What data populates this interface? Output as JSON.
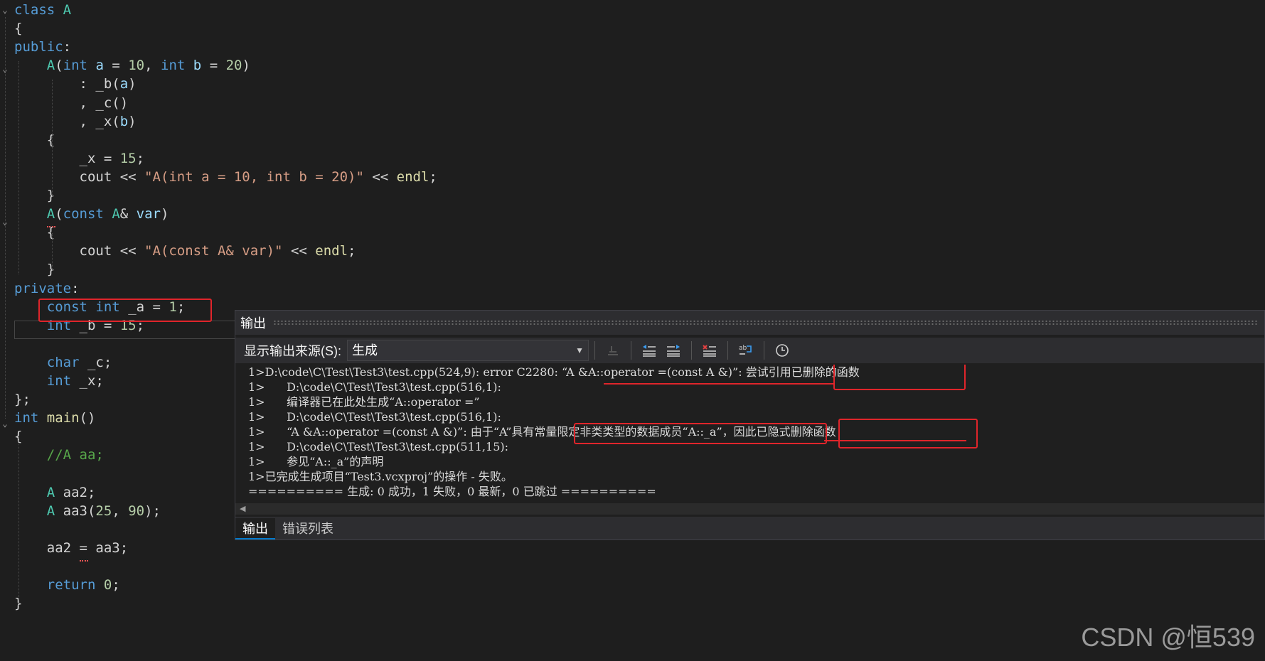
{
  "editor": {
    "lines": [
      [
        {
          "c": "kw",
          "t": "class "
        },
        {
          "c": "ty",
          "t": "A"
        }
      ],
      [
        {
          "c": "tx",
          "t": "{"
        }
      ],
      [
        {
          "c": "kw",
          "t": "public"
        },
        {
          "c": "tx",
          "t": ":"
        }
      ],
      [
        {
          "c": "tx",
          "t": "    "
        },
        {
          "c": "ty",
          "t": "A"
        },
        {
          "c": "tx",
          "t": "("
        },
        {
          "c": "kw",
          "t": "int"
        },
        {
          "c": "tx",
          "t": " "
        },
        {
          "c": "pr",
          "t": "a"
        },
        {
          "c": "tx",
          "t": " = "
        },
        {
          "c": "nm",
          "t": "10"
        },
        {
          "c": "tx",
          "t": ", "
        },
        {
          "c": "kw",
          "t": "int"
        },
        {
          "c": "tx",
          "t": " "
        },
        {
          "c": "pr",
          "t": "b"
        },
        {
          "c": "tx",
          "t": " = "
        },
        {
          "c": "nm",
          "t": "20"
        },
        {
          "c": "tx",
          "t": ")"
        }
      ],
      [
        {
          "c": "tx",
          "t": "        : _b("
        },
        {
          "c": "pr",
          "t": "a"
        },
        {
          "c": "tx",
          "t": ")"
        }
      ],
      [
        {
          "c": "tx",
          "t": "        , _c()"
        }
      ],
      [
        {
          "c": "tx",
          "t": "        , _x("
        },
        {
          "c": "pr",
          "t": "b"
        },
        {
          "c": "tx",
          "t": ")"
        }
      ],
      [
        {
          "c": "tx",
          "t": "    {"
        }
      ],
      [
        {
          "c": "tx",
          "t": "        _x = "
        },
        {
          "c": "nm",
          "t": "15"
        },
        {
          "c": "tx",
          "t": ";"
        }
      ],
      [
        {
          "c": "tx",
          "t": "        cout << "
        },
        {
          "c": "st",
          "t": "\"A(int a = 10, int b = 20)\""
        },
        {
          "c": "tx",
          "t": " << "
        },
        {
          "c": "fn",
          "t": "endl"
        },
        {
          "c": "tx",
          "t": ";"
        }
      ],
      [
        {
          "c": "tx",
          "t": "    }"
        }
      ],
      [
        {
          "c": "tx",
          "t": "    "
        },
        {
          "c": "ty",
          "t": "A"
        },
        {
          "c": "tx",
          "t": "("
        },
        {
          "c": "kw",
          "t": "const"
        },
        {
          "c": "tx",
          "t": " "
        },
        {
          "c": "ty",
          "t": "A"
        },
        {
          "c": "tx",
          "t": "& "
        },
        {
          "c": "pr",
          "t": "var"
        },
        {
          "c": "tx",
          "t": ")"
        }
      ],
      [
        {
          "c": "tx",
          "t": "    {"
        }
      ],
      [
        {
          "c": "tx",
          "t": "        cout << "
        },
        {
          "c": "st",
          "t": "\"A(const A& var)\""
        },
        {
          "c": "tx",
          "t": " << "
        },
        {
          "c": "fn",
          "t": "endl"
        },
        {
          "c": "tx",
          "t": ";"
        }
      ],
      [
        {
          "c": "tx",
          "t": "    }"
        }
      ],
      [
        {
          "c": "kw",
          "t": "private"
        },
        {
          "c": "tx",
          "t": ":"
        }
      ],
      [
        {
          "c": "tx",
          "t": "    "
        },
        {
          "c": "kw",
          "t": "const"
        },
        {
          "c": "tx",
          "t": " "
        },
        {
          "c": "kw",
          "t": "int"
        },
        {
          "c": "tx",
          "t": " _a = "
        },
        {
          "c": "nm",
          "t": "1"
        },
        {
          "c": "tx",
          "t": ";"
        }
      ],
      [
        {
          "c": "tx",
          "t": "    "
        },
        {
          "c": "kw",
          "t": "int"
        },
        {
          "c": "tx",
          "t": " _b = "
        },
        {
          "c": "nm",
          "t": "15"
        },
        {
          "c": "tx",
          "t": ";"
        }
      ],
      [
        {
          "c": "tx",
          "t": ""
        }
      ],
      [
        {
          "c": "tx",
          "t": "    "
        },
        {
          "c": "kw",
          "t": "char"
        },
        {
          "c": "tx",
          "t": " _c;"
        }
      ],
      [
        {
          "c": "tx",
          "t": "    "
        },
        {
          "c": "kw",
          "t": "int"
        },
        {
          "c": "tx",
          "t": " _x;"
        }
      ],
      [
        {
          "c": "tx",
          "t": "};"
        }
      ],
      [
        {
          "c": "kw",
          "t": "int"
        },
        {
          "c": "tx",
          "t": " "
        },
        {
          "c": "fn",
          "t": "main"
        },
        {
          "c": "tx",
          "t": "()"
        }
      ],
      [
        {
          "c": "tx",
          "t": "{"
        }
      ],
      [
        {
          "c": "tx",
          "t": "    "
        },
        {
          "c": "cm",
          "t": "//A aa;"
        }
      ],
      [
        {
          "c": "tx",
          "t": ""
        }
      ],
      [
        {
          "c": "tx",
          "t": "    "
        },
        {
          "c": "ty",
          "t": "A"
        },
        {
          "c": "tx",
          "t": " aa2;"
        }
      ],
      [
        {
          "c": "tx",
          "t": "    "
        },
        {
          "c": "ty",
          "t": "A"
        },
        {
          "c": "tx",
          "t": " aa3("
        },
        {
          "c": "nm",
          "t": "25"
        },
        {
          "c": "tx",
          "t": ", "
        },
        {
          "c": "nm",
          "t": "90"
        },
        {
          "c": "tx",
          "t": ");"
        }
      ],
      [
        {
          "c": "tx",
          "t": ""
        }
      ],
      [
        {
          "c": "tx",
          "t": "    aa2 = aa3;"
        }
      ],
      [
        {
          "c": "tx",
          "t": ""
        }
      ],
      [
        {
          "c": "tx",
          "t": "    "
        },
        {
          "c": "kw",
          "t": "return"
        },
        {
          "c": "tx",
          "t": " "
        },
        {
          "c": "nm",
          "t": "0"
        },
        {
          "c": "tx",
          "t": ";"
        }
      ],
      [
        {
          "c": "tx",
          "t": "}"
        }
      ]
    ]
  },
  "output": {
    "title": "输出",
    "source_label": "显示输出来源(S):",
    "source_value": "生成",
    "lines": [
      "1>D:\\code\\C\\Test\\Test3\\test.cpp(524,9): error C2280: “A &A::operator =(const A &)”: 尝试引用已删除的函数",
      "1>      D:\\code\\C\\Test\\Test3\\test.cpp(516,1):",
      "1>      编译器已在此处生成“A::operator =”",
      "1>      D:\\code\\C\\Test\\Test3\\test.cpp(516,1):",
      "1>      “A &A::operator =(const A &)”: 由于“A”具有常量限定非类类型的数据成员“A::_a”，因此已隐式删除函数",
      "1>      D:\\code\\C\\Test\\Test3\\test.cpp(511,15):",
      "1>      参见“A::_a”的声明",
      "1>已完成生成项目“Test3.vcxproj”的操作 - 失败。",
      "========== 生成: 0 成功，1 失败，0 最新，0 已跳过 =========="
    ],
    "tabs": [
      "输出",
      "错误列表"
    ]
  },
  "watermark": "CSDN @恒539",
  "colors": {
    "annotation": "#e0252b",
    "background": "#1e1e1e"
  }
}
